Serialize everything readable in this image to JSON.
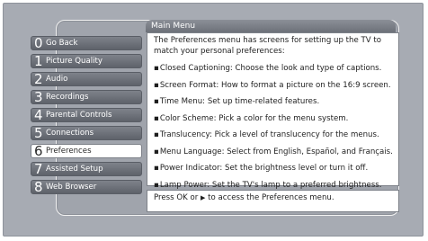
{
  "menu": {
    "title": "Main Menu",
    "items": [
      {
        "num": "0",
        "label": "Go Back"
      },
      {
        "num": "1",
        "label": "Picture Quality"
      },
      {
        "num": "2",
        "label": "Audio"
      },
      {
        "num": "3",
        "label": "Recordings"
      },
      {
        "num": "4",
        "label": "Parental Controls"
      },
      {
        "num": "5",
        "label": "Connections"
      },
      {
        "num": "6",
        "label": "Preferences"
      },
      {
        "num": "7",
        "label": "Assisted Setup"
      },
      {
        "num": "8",
        "label": "Web Browser"
      }
    ],
    "selected_index": 6
  },
  "description": {
    "intro": "The Preferences menu has screens for setting up the TV to match your personal preferences:",
    "bullets": [
      "Closed Captioning: Choose the look and type of captions.",
      "Screen Format: How to format a picture on the 16:9 screen.",
      "Time Menu: Set up time-related features.",
      "Color Scheme: Pick a color for the menu system.",
      "Translucency: Pick a level of translucency for the menus.",
      "Menu Language: Select from English, Español, and Français.",
      "Power Indicator: Set the brightness level or turn it off.",
      "Lamp Power: Set the TV's lamp to a preferred brightness."
    ]
  },
  "hint": {
    "before": "Press OK or ",
    "arrow": "▶",
    "after": " to access the Preferences menu."
  },
  "colors": {
    "background": "#a7abb3",
    "button": "#6e727a",
    "selected": "#ffffff"
  },
  "icons": {
    "bullet": "small-square-bullet-icon",
    "hint_arrow": "right-arrow-icon"
  }
}
